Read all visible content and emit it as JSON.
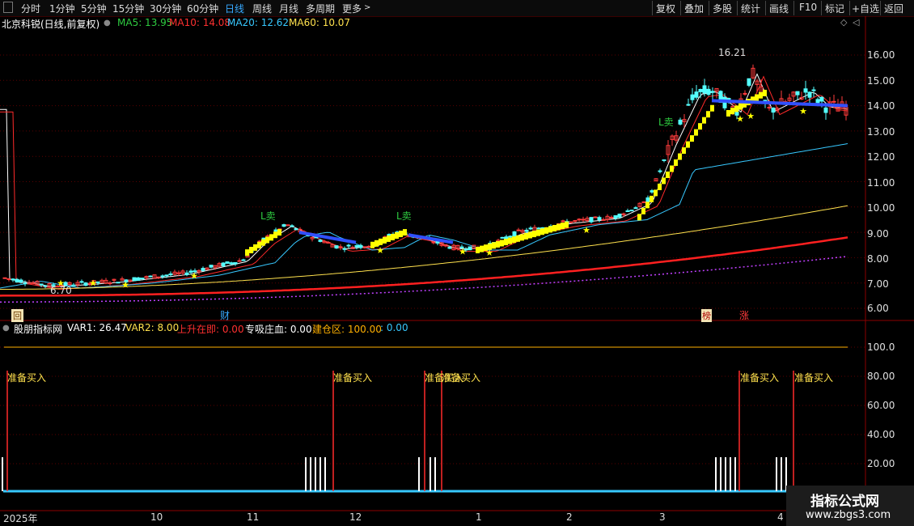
{
  "toolbar": {
    "left_tabs": [
      "分时",
      "1分钟",
      "5分钟",
      "15分钟",
      "30分钟",
      "60分钟",
      "日线",
      "周线",
      "月线",
      "多周期",
      "更多"
    ],
    "active_tab": "日线",
    "right_buttons": [
      "复权",
      "叠加",
      "多股",
      "统计",
      "画线",
      "F10",
      "标记",
      "+自选",
      "返回"
    ]
  },
  "stock": {
    "title": "北京科锐(日线,前复权)",
    "ma": [
      {
        "label": "MA5: 13.95",
        "color": "#2ecc40"
      },
      {
        "label": "MA10: 14.08",
        "color": "#ff3030"
      },
      {
        "label": "MA20: 12.62",
        "color": "#37c8ff"
      },
      {
        "label": "MA60: 10.07",
        "color": "#ffe14d"
      }
    ],
    "high_label": "16.21",
    "low_label": "6.70",
    "sell_marker": "L卖"
  },
  "price_axis": [
    "16.00",
    "15.00",
    "14.00",
    "13.00",
    "12.00",
    "11.00",
    "10.00",
    "9.00",
    "8.00",
    "7.00",
    "6.00"
  ],
  "indicator": {
    "name": "股朋指标网",
    "var1": "VAR1: 26.47",
    "var2": "VAR2: 8.00",
    "up": "上升在即: 0.00",
    "absorb": "专吸庄血: 0.00",
    "build": "建仓区: 100.00",
    "extra": ": 0.00",
    "signal_label": "准备买入",
    "axis": [
      "100.0",
      "80.00",
      "60.00",
      "40.00",
      "20.00"
    ]
  },
  "markers": {
    "hui": "回",
    "cai": "财",
    "bang": "榜",
    "zhang": "涨"
  },
  "time_axis": [
    "2025年",
    "10",
    "11",
    "12",
    "1",
    "2",
    "3",
    "4"
  ],
  "watermark": {
    "title": "指标公式网",
    "url": "www.zbgs3.com"
  },
  "colors": {
    "up": "#ff3b3b",
    "down": "#54ffff",
    "ma5": "#ffffff",
    "ma10": "#ff2a2a",
    "ma20": "#37c8ff",
    "ma60": "#ffe14d",
    "ma120": "#ff2020",
    "ma250": "#c040ff",
    "bars": "#ffff00",
    "grid": "#5a0000"
  }
}
